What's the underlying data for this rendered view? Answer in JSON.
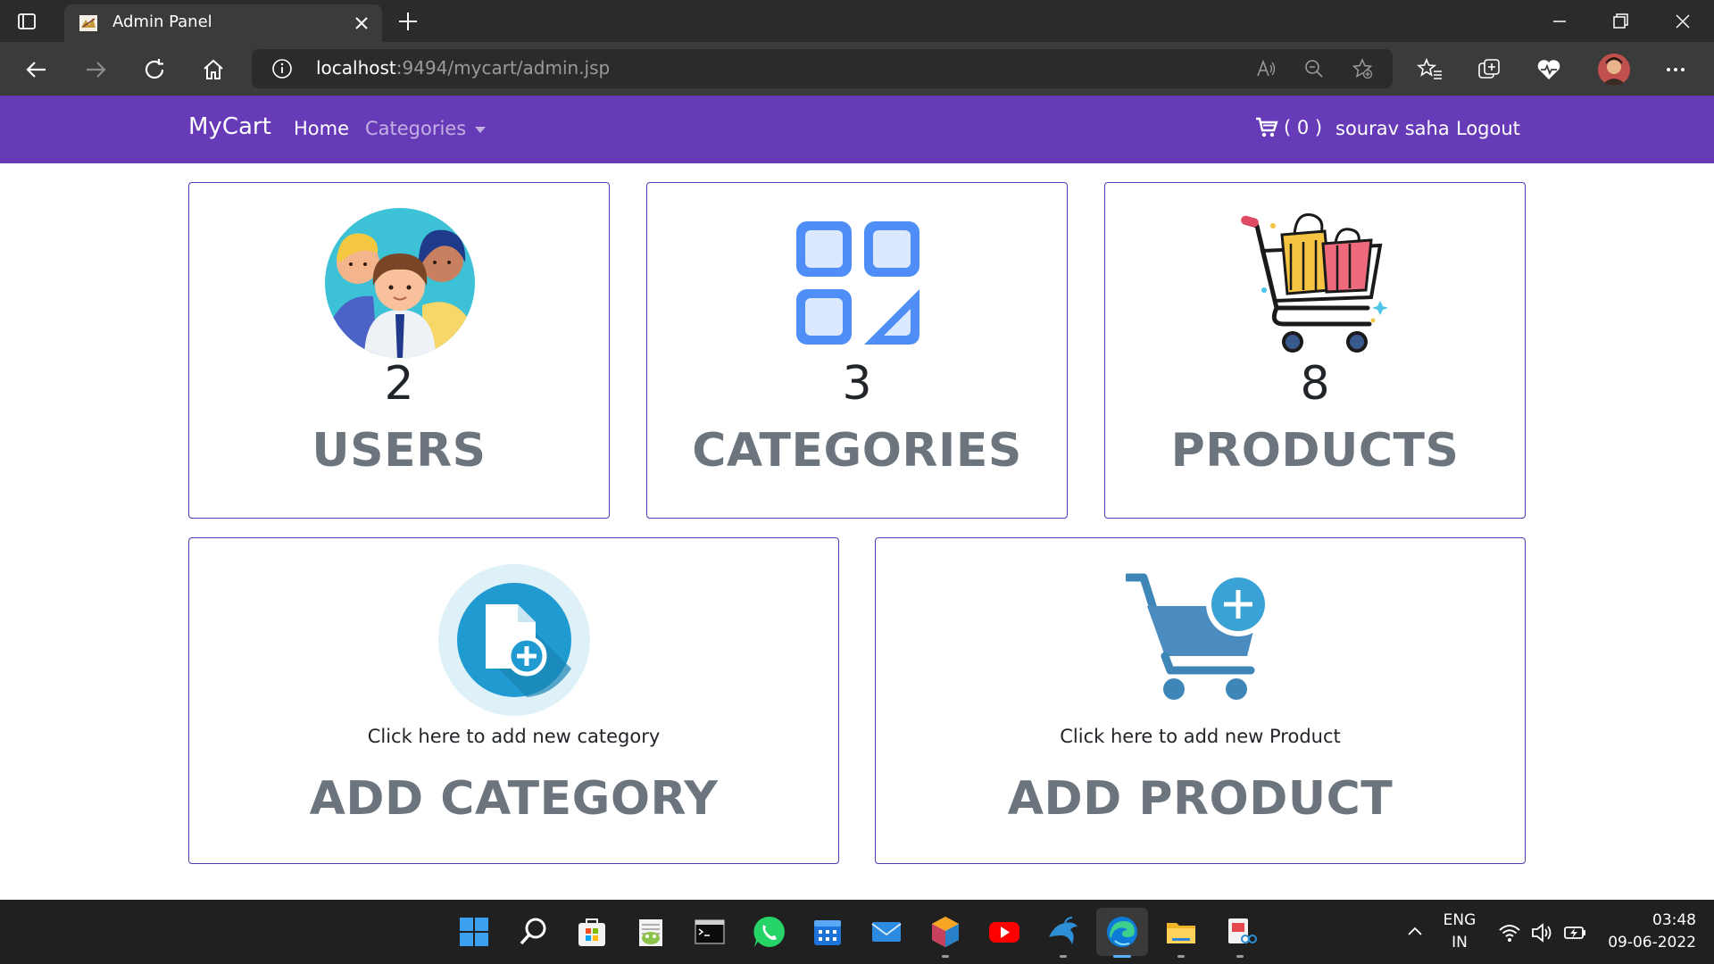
{
  "browser": {
    "tab_title": "Admin Panel",
    "url_host": "localhost",
    "url_rest": ":9494/mycart/admin.jsp"
  },
  "navbar": {
    "brand": "MyCart",
    "home": "Home",
    "categories": "Categories",
    "cart_label": "( 0 )",
    "user_name": "sourav saha",
    "logout": "Logout",
    "color": "#673ab7"
  },
  "stats": [
    {
      "count": "2",
      "label": "USERS",
      "icon": "users-icon"
    },
    {
      "count": "3",
      "label": "CATEGORIES",
      "icon": "categories-icon"
    },
    {
      "count": "8",
      "label": "PRODUCTS",
      "icon": "products-icon"
    }
  ],
  "actions": [
    {
      "hint": "Click here to add new category",
      "label": "ADD CATEGORY",
      "icon": "add-file-icon"
    },
    {
      "hint": "Click here to add new Product",
      "label": "ADD PRODUCT",
      "icon": "add-cart-icon"
    }
  ],
  "taskbar": {
    "lang_top": "ENG",
    "lang_bottom": "IN",
    "time": "03:48",
    "date": "09-06-2022"
  }
}
